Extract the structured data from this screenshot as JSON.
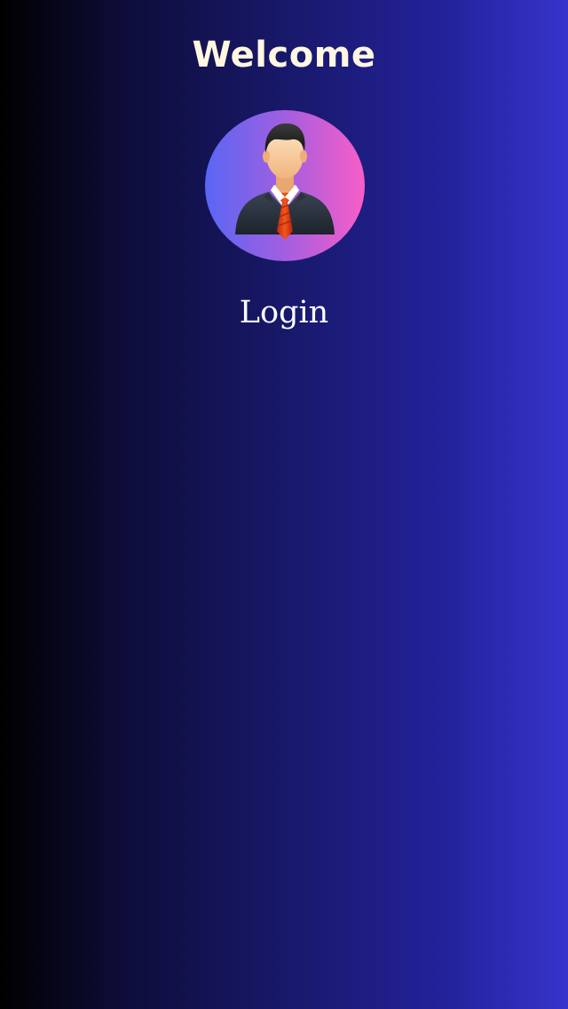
{
  "header": {
    "title": "Welcome"
  },
  "avatar": {
    "icon": "user-avatar-icon",
    "gradient_colors": [
      "#5867f5",
      "#a35ee0",
      "#f85ec7"
    ]
  },
  "main": {
    "login_label": "Login"
  },
  "colors": {
    "background_start": "#000000",
    "background_end": "#3633cc",
    "title_text": "#fff7e0",
    "login_text": "#ffffff"
  }
}
